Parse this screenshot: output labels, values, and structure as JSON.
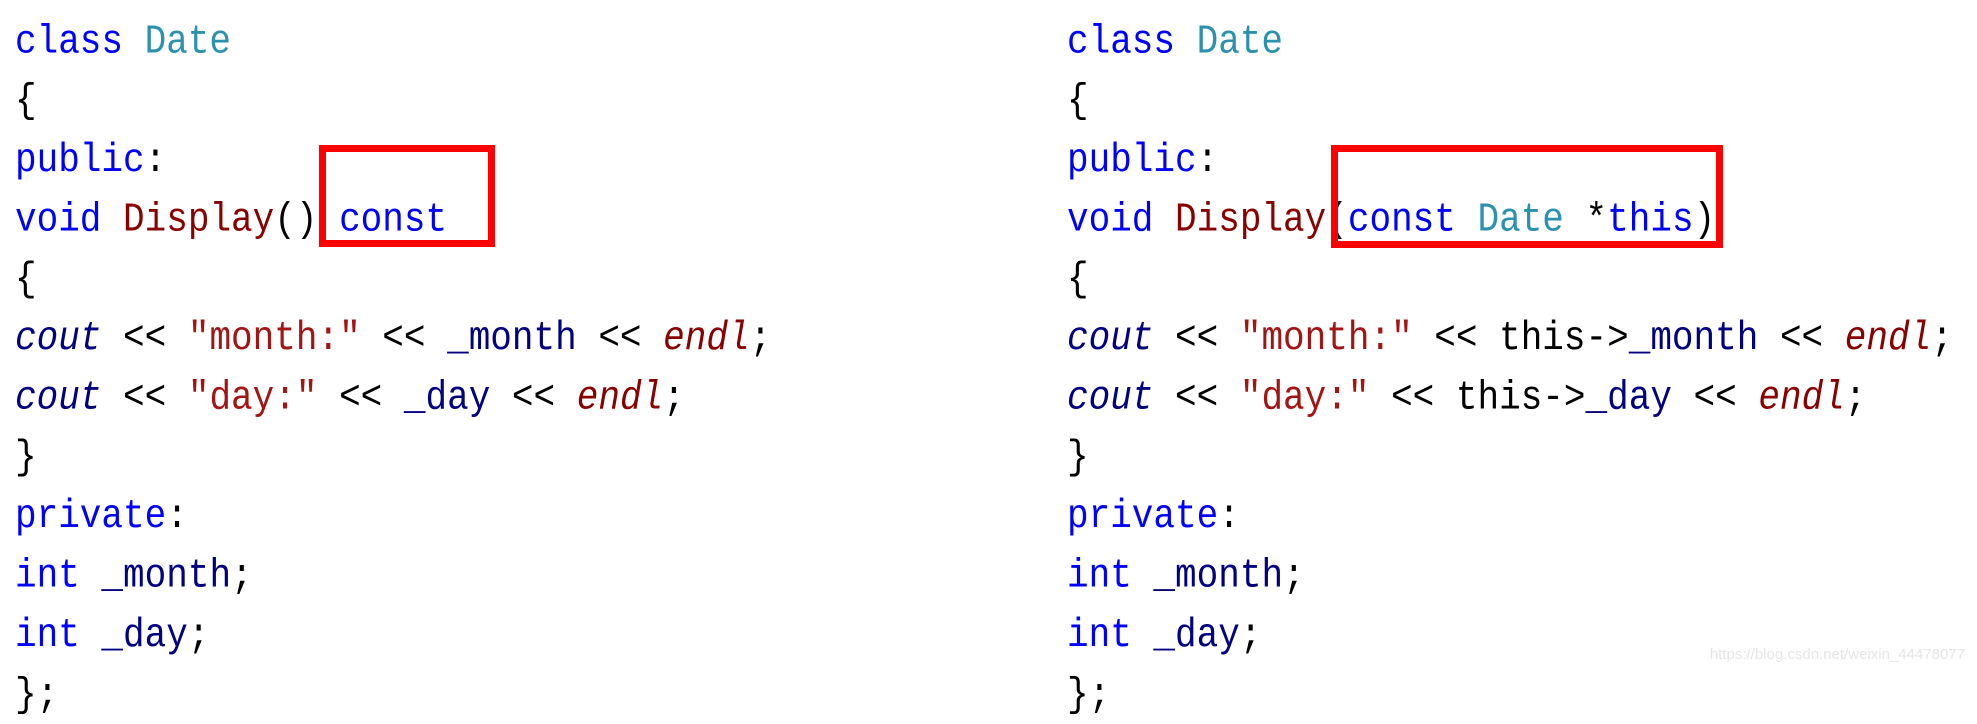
{
  "left_code": [
    [
      [
        "kw",
        "class "
      ],
      [
        "ty",
        "Date"
      ]
    ],
    [
      [
        "plain",
        "{"
      ]
    ],
    [
      [
        "kw",
        "public"
      ],
      [
        "plain",
        ":"
      ]
    ],
    [
      [
        "kw",
        "void "
      ],
      [
        "fn",
        "Display"
      ],
      [
        "plain",
        "() "
      ],
      [
        "kw",
        "const"
      ]
    ],
    [
      [
        "plain",
        "{"
      ]
    ],
    [
      [
        "var it",
        "cout"
      ],
      [
        "plain",
        " << "
      ],
      [
        "str",
        "\"month:\""
      ],
      [
        "plain",
        " << "
      ],
      [
        "var",
        "_month"
      ],
      [
        "plain",
        " << "
      ],
      [
        "endl",
        "endl"
      ],
      [
        "plain",
        ";"
      ]
    ],
    [
      [
        "var it",
        "cout"
      ],
      [
        "plain",
        " << "
      ],
      [
        "str",
        "\"day:\""
      ],
      [
        "plain",
        " << "
      ],
      [
        "var",
        "_day"
      ],
      [
        "plain",
        " << "
      ],
      [
        "endl",
        "endl"
      ],
      [
        "plain",
        ";"
      ]
    ],
    [
      [
        "plain",
        "}"
      ]
    ],
    [
      [
        "kw",
        "private"
      ],
      [
        "plain",
        ":"
      ]
    ],
    [
      [
        "kw",
        "int "
      ],
      [
        "var",
        "_month"
      ],
      [
        "plain",
        ";"
      ]
    ],
    [
      [
        "kw",
        "int "
      ],
      [
        "var",
        "_day"
      ],
      [
        "plain",
        ";"
      ]
    ],
    [
      [
        "plain",
        "};"
      ]
    ]
  ],
  "right_code": [
    [
      [
        "kw",
        "class "
      ],
      [
        "ty",
        "Date"
      ]
    ],
    [
      [
        "plain",
        "{"
      ]
    ],
    [
      [
        "kw",
        "public"
      ],
      [
        "plain",
        ":"
      ]
    ],
    [
      [
        "kw",
        "void "
      ],
      [
        "fn",
        "Display"
      ],
      [
        "plain",
        "("
      ],
      [
        "kw",
        "const "
      ],
      [
        "ty",
        "Date "
      ],
      [
        "plain",
        "*"
      ],
      [
        "kw",
        "this"
      ],
      [
        "plain",
        ")"
      ]
    ],
    [
      [
        "plain",
        "{"
      ]
    ],
    [
      [
        "var it",
        "cout"
      ],
      [
        "plain",
        " << "
      ],
      [
        "str",
        "\"month:\""
      ],
      [
        "plain",
        " << this->"
      ],
      [
        "var",
        "_month"
      ],
      [
        "plain",
        " << "
      ],
      [
        "endl",
        "endl"
      ],
      [
        "plain",
        ";"
      ]
    ],
    [
      [
        "var it",
        "cout"
      ],
      [
        "plain",
        " << "
      ],
      [
        "str",
        "\"day:\""
      ],
      [
        "plain",
        " << this->"
      ],
      [
        "var",
        "_day"
      ],
      [
        "plain",
        " << "
      ],
      [
        "endl",
        "endl"
      ],
      [
        "plain",
        ";"
      ]
    ],
    [
      [
        "plain",
        "}"
      ]
    ],
    [
      [
        "kw",
        "private"
      ],
      [
        "plain",
        ":"
      ]
    ],
    [
      [
        "kw",
        "int "
      ],
      [
        "var",
        "_month"
      ],
      [
        "plain",
        ";"
      ]
    ],
    [
      [
        "kw",
        "int "
      ],
      [
        "var",
        "_day"
      ],
      [
        "plain",
        ";"
      ]
    ],
    [
      [
        "plain",
        "};"
      ]
    ]
  ],
  "highlight_color": "#ff0000",
  "watermark": "https://blog.csdn.net/weixin_44478077"
}
